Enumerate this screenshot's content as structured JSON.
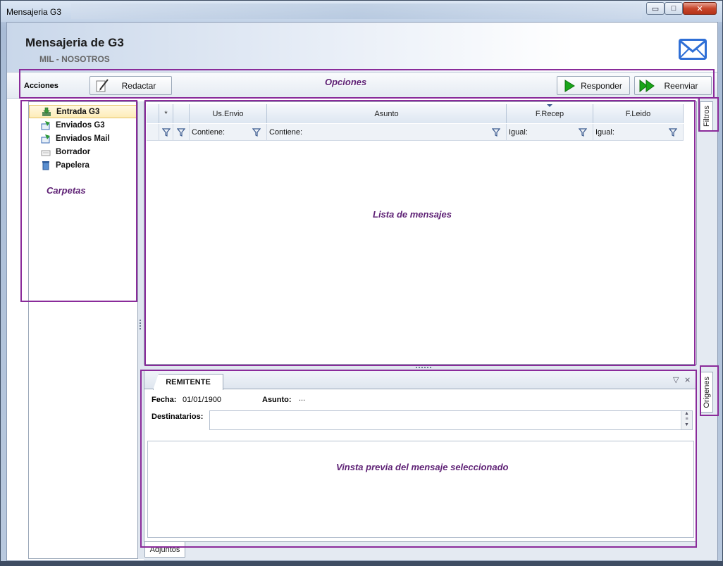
{
  "window": {
    "title": "Mensajeria G3",
    "minimize_glyph": "▭",
    "maximize_glyph": "□",
    "close_glyph": "✕"
  },
  "header": {
    "title": "Mensajeria de G3",
    "subtitle": "MIL - NOSOTROS",
    "icon": "mail-envelope-icon"
  },
  "toolbar": {
    "acciones_label": "Acciones",
    "redactar_label": "Redactar",
    "responder_label": "Responder",
    "reenviar_label": "Reenviar"
  },
  "folders": {
    "items": [
      {
        "label": "Entrada G3",
        "icon": "inbox-download-icon",
        "selected": true
      },
      {
        "label": "Enviados G3",
        "icon": "sent-mail-icon",
        "selected": false
      },
      {
        "label": "Enviados Mail",
        "icon": "sent-mail-icon",
        "selected": false
      },
      {
        "label": "Borrador",
        "icon": "draft-icon",
        "selected": false
      },
      {
        "label": "Papelera",
        "icon": "trash-icon",
        "selected": false
      }
    ]
  },
  "grid": {
    "columns": [
      "",
      "*",
      "",
      "Us.Envio",
      "Asunto",
      "F.Recep",
      "F.Leido"
    ],
    "filters": [
      "",
      "",
      "",
      "Contiene:",
      "Contiene:",
      "Igual:",
      "Igual:"
    ]
  },
  "preview": {
    "tab_label": "REMITENTE",
    "tab_ctrl_down": "▽",
    "tab_ctrl_close": "⨯",
    "fecha_label": "Fecha:",
    "fecha_value": "01/01/1900",
    "asunto_label": "Asunto:",
    "asunto_value": "...",
    "destinatarios_label": "Destinatarios:"
  },
  "bottom_tabs": {
    "adjuntos_label": "Adjuntos"
  },
  "side_tabs": {
    "filtros_label": "Filtros",
    "origenes_label": "Origenes"
  },
  "annotations": {
    "opciones": "Opciones",
    "carpetas": "Carpetas",
    "lista": "Lista de mensajes",
    "vista_previa": "Vinsta previa del mensaje seleccionado"
  },
  "colors": {
    "annotation_purple": "#8a2b9a",
    "accent_blue": "#2f6fd6",
    "play_green": "#19a619"
  }
}
